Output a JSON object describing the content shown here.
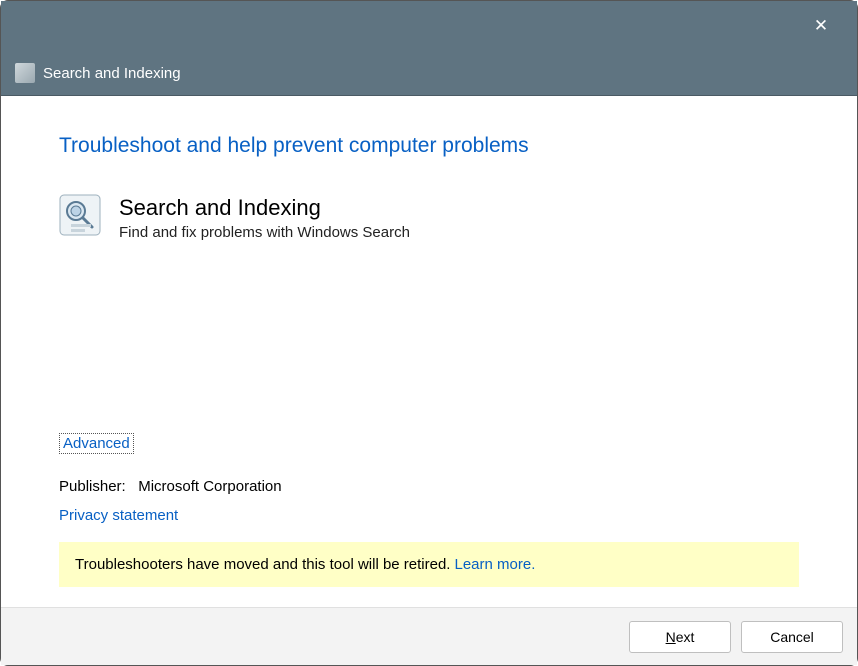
{
  "titlebar": {
    "close_glyph": "✕"
  },
  "header": {
    "title": "Search and Indexing"
  },
  "content": {
    "main_heading": "Troubleshoot and help prevent computer problems",
    "app_title": "Search and Indexing",
    "app_subtitle": "Find and fix problems with Windows Search",
    "advanced_label": "Advanced",
    "publisher_label": "Publisher:",
    "publisher_value": "Microsoft Corporation",
    "privacy_label": "Privacy statement",
    "notice_text": "Troubleshooters have moved and this tool will be retired.",
    "notice_link": "Learn more."
  },
  "footer": {
    "next_prefix": "N",
    "next_suffix": "ext",
    "cancel_label": "Cancel"
  }
}
